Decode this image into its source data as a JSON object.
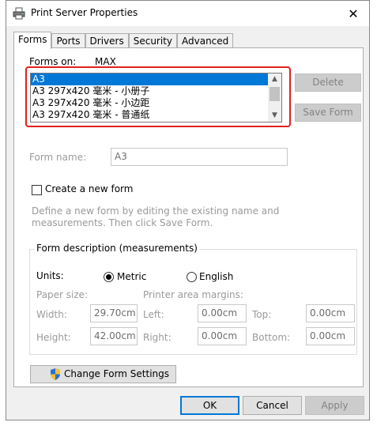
{
  "window": {
    "title": "Print Server Properties",
    "close_glyph": "✕"
  },
  "tabs": [
    {
      "label": "Forms",
      "active": true
    },
    {
      "label": "Ports",
      "active": false
    },
    {
      "label": "Drivers",
      "active": false
    },
    {
      "label": "Security",
      "active": false
    },
    {
      "label": "Advanced",
      "active": false
    }
  ],
  "forms_on": {
    "label": "Forms on:",
    "server": "MAX"
  },
  "forms_list": {
    "items": [
      "A3",
      "A3 297x420 毫米 - 小册子",
      "A3 297x420 毫米 - 小边距",
      "A3 297x420 毫米 - 普通纸"
    ],
    "selected": "A3"
  },
  "buttons": {
    "delete": "Delete",
    "save_form": "Save Form",
    "change_settings": "Change Form Settings",
    "ok": "OK",
    "cancel": "Cancel",
    "apply": "Apply"
  },
  "form_name": {
    "label": "Form name:",
    "value": "A3"
  },
  "create_new": {
    "label": "Create a new form",
    "checked": false
  },
  "help_text": {
    "line1": "Define a new form by editing the existing name and",
    "line2": "measurements. Then click Save Form."
  },
  "description": {
    "title": "Form description (measurements)",
    "units_label": "Units:",
    "metric": "Metric",
    "english": "English",
    "paper_size": "Paper size:",
    "printer_margins": "Printer area margins:",
    "width_label": "Width:",
    "width_value": "29.70cm",
    "height_label": "Height:",
    "height_value": "42.00cm",
    "left_label": "Left:",
    "left_value": "0.00cm",
    "right_label": "Right:",
    "right_value": "0.00cm",
    "top_label": "Top:",
    "top_value": "0.00cm",
    "bottom_label": "Bottom:",
    "bottom_value": "0.00cm",
    "selected_unit": "Metric"
  },
  "colors": {
    "selection": "#0078d7",
    "highlight_border": "#e0211d",
    "accent": "#0078d7"
  },
  "icons": {
    "title": "printer-icon",
    "change_settings": "uac-shield-icon"
  }
}
